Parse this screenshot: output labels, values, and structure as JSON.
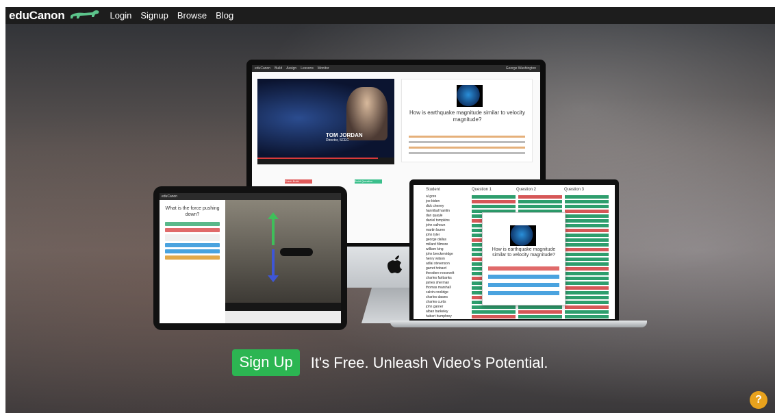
{
  "header": {
    "brand": "eduCanon",
    "nav": [
      "Login",
      "Signup",
      "Browse",
      "Blog"
    ]
  },
  "cta": {
    "button_label": "Sign Up",
    "tagline": "It's Free. Unleash Video's Potential."
  },
  "help": {
    "icon": "?"
  },
  "imac": {
    "topbar_brand": "eduCanon",
    "topbar_items": [
      "Build",
      "Assign",
      "Lessons",
      "Monitor"
    ],
    "user": "George Washington",
    "video_caption_name": "TOM JORDAN",
    "video_caption_title": "Director, SCEC",
    "question": "How is earthquake magnitude similar to velocity magnitude?",
    "finish_button": "Finish Build",
    "build_button": "Build Question"
  },
  "ipad": {
    "topbar_brand": "eduCanon",
    "question": "What is the force pushing down?"
  },
  "laptop": {
    "headers": [
      "Student",
      "Question 1",
      "Question 2",
      "Question 3"
    ],
    "students": [
      "al gore",
      "joe biden",
      "dick cheney",
      "hannibal hamlin",
      "dan quayle",
      "daniel tompkins",
      "john calhoun",
      "martin buren",
      "john tyler",
      "george dallas",
      "millard fillmore",
      "william king",
      "john breckenridge",
      "henry wilson",
      "adlai stevenson",
      "garret hobard",
      "theodore roosevelt",
      "charles fairbanks",
      "james sherman",
      "thomas marshall",
      "calvin coolidge",
      "charles dawes",
      "charles curtis",
      "john garner",
      "alban barkeley",
      "hubert humphrey"
    ],
    "modal_question": "How is earthquake magnitude similar to velocity magnitude?"
  },
  "colors": {
    "accent": "#2cb552",
    "topbar": "#1d1d1d",
    "help": "#e8a21d"
  }
}
